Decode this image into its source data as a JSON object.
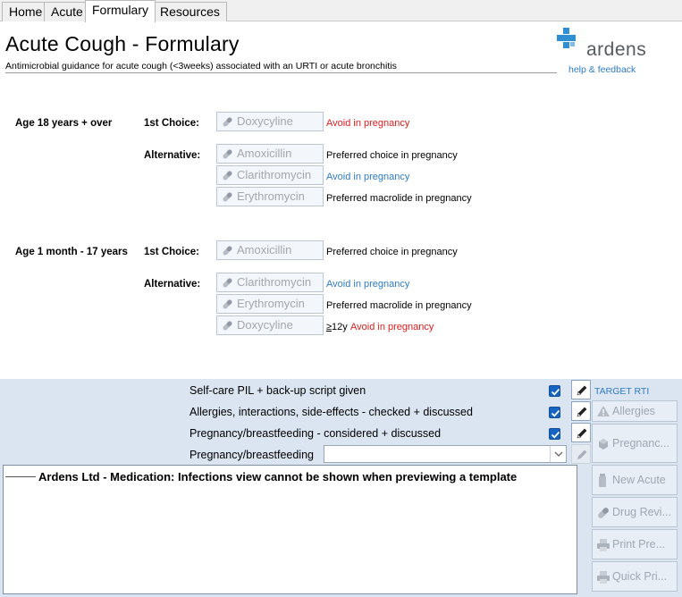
{
  "tabs": [
    {
      "label": "Home"
    },
    {
      "label": "Acute"
    },
    {
      "label": "Formulary"
    },
    {
      "label": "Resources"
    }
  ],
  "header": {
    "title": "Acute Cough - Formulary",
    "subtitle": "Antimicrobial guidance for acute cough (<3weeks) associated with an URTI or acute bronchitis",
    "logo_text": "ardens",
    "help_link": "help & feedback"
  },
  "adults": {
    "group_label": "Age 18 years + over",
    "first_choice_label": "1st Choice:",
    "alternative_label": "Alternative:",
    "first": {
      "drug": "Doxycyline",
      "note": "Avoid in pregnancy"
    },
    "alternatives": [
      {
        "drug": "Amoxicillin",
        "note": "Preferred choice in pregnancy"
      },
      {
        "drug": "Clarithromycin",
        "note": "Avoid in pregnancy"
      },
      {
        "drug": "Erythromycin",
        "note": "Preferred macrolide in pregnancy"
      }
    ]
  },
  "children": {
    "group_label": "Age 1 month - 17 years",
    "first_choice_label": "1st Choice:",
    "alternative_label": "Alternative:",
    "first": {
      "drug": "Amoxicillin",
      "note": "Preferred choice in pregnancy"
    },
    "alternatives": [
      {
        "drug": "Clarithromycin",
        "note": "Avoid in pregnancy"
      },
      {
        "drug": "Erythromycin",
        "note": "Preferred macrolide in pregnancy"
      },
      {
        "drug": "Doxycyline",
        "note_prefix_symbol": "≥",
        "note_prefix": "12y",
        "note": "Avoid in pregnancy"
      }
    ]
  },
  "checklist": [
    {
      "label": "Self-care PIL + back-up script given",
      "checked": true
    },
    {
      "label": "Allergies, interactions, side-effects - checked + discussed",
      "checked": true
    },
    {
      "label": "Pregnancy/breastfeeding - considered + discussed",
      "checked": true
    }
  ],
  "pregnancy_field": {
    "label": "Pregnancy/breastfeeding",
    "value": ""
  },
  "target_label": "TARGET RTI",
  "side_buttons": [
    {
      "label": "Allergies"
    },
    {
      "label": "Pregnanc..."
    },
    {
      "label": "New Acute"
    },
    {
      "label": "Drug Revi..."
    },
    {
      "label": "Print Pre..."
    },
    {
      "label": "Quick Pri..."
    }
  ],
  "view_message": "Ardens Ltd - Medication: Infections view cannot be shown when previewing a template",
  "colors": {
    "accent_blue": "#2e7bc4",
    "warning_red": "#e01b1b",
    "panel_bg": "#dbe5f1",
    "checkbox_blue": "#1565c0",
    "logo_blue": "#2f8fd2"
  }
}
